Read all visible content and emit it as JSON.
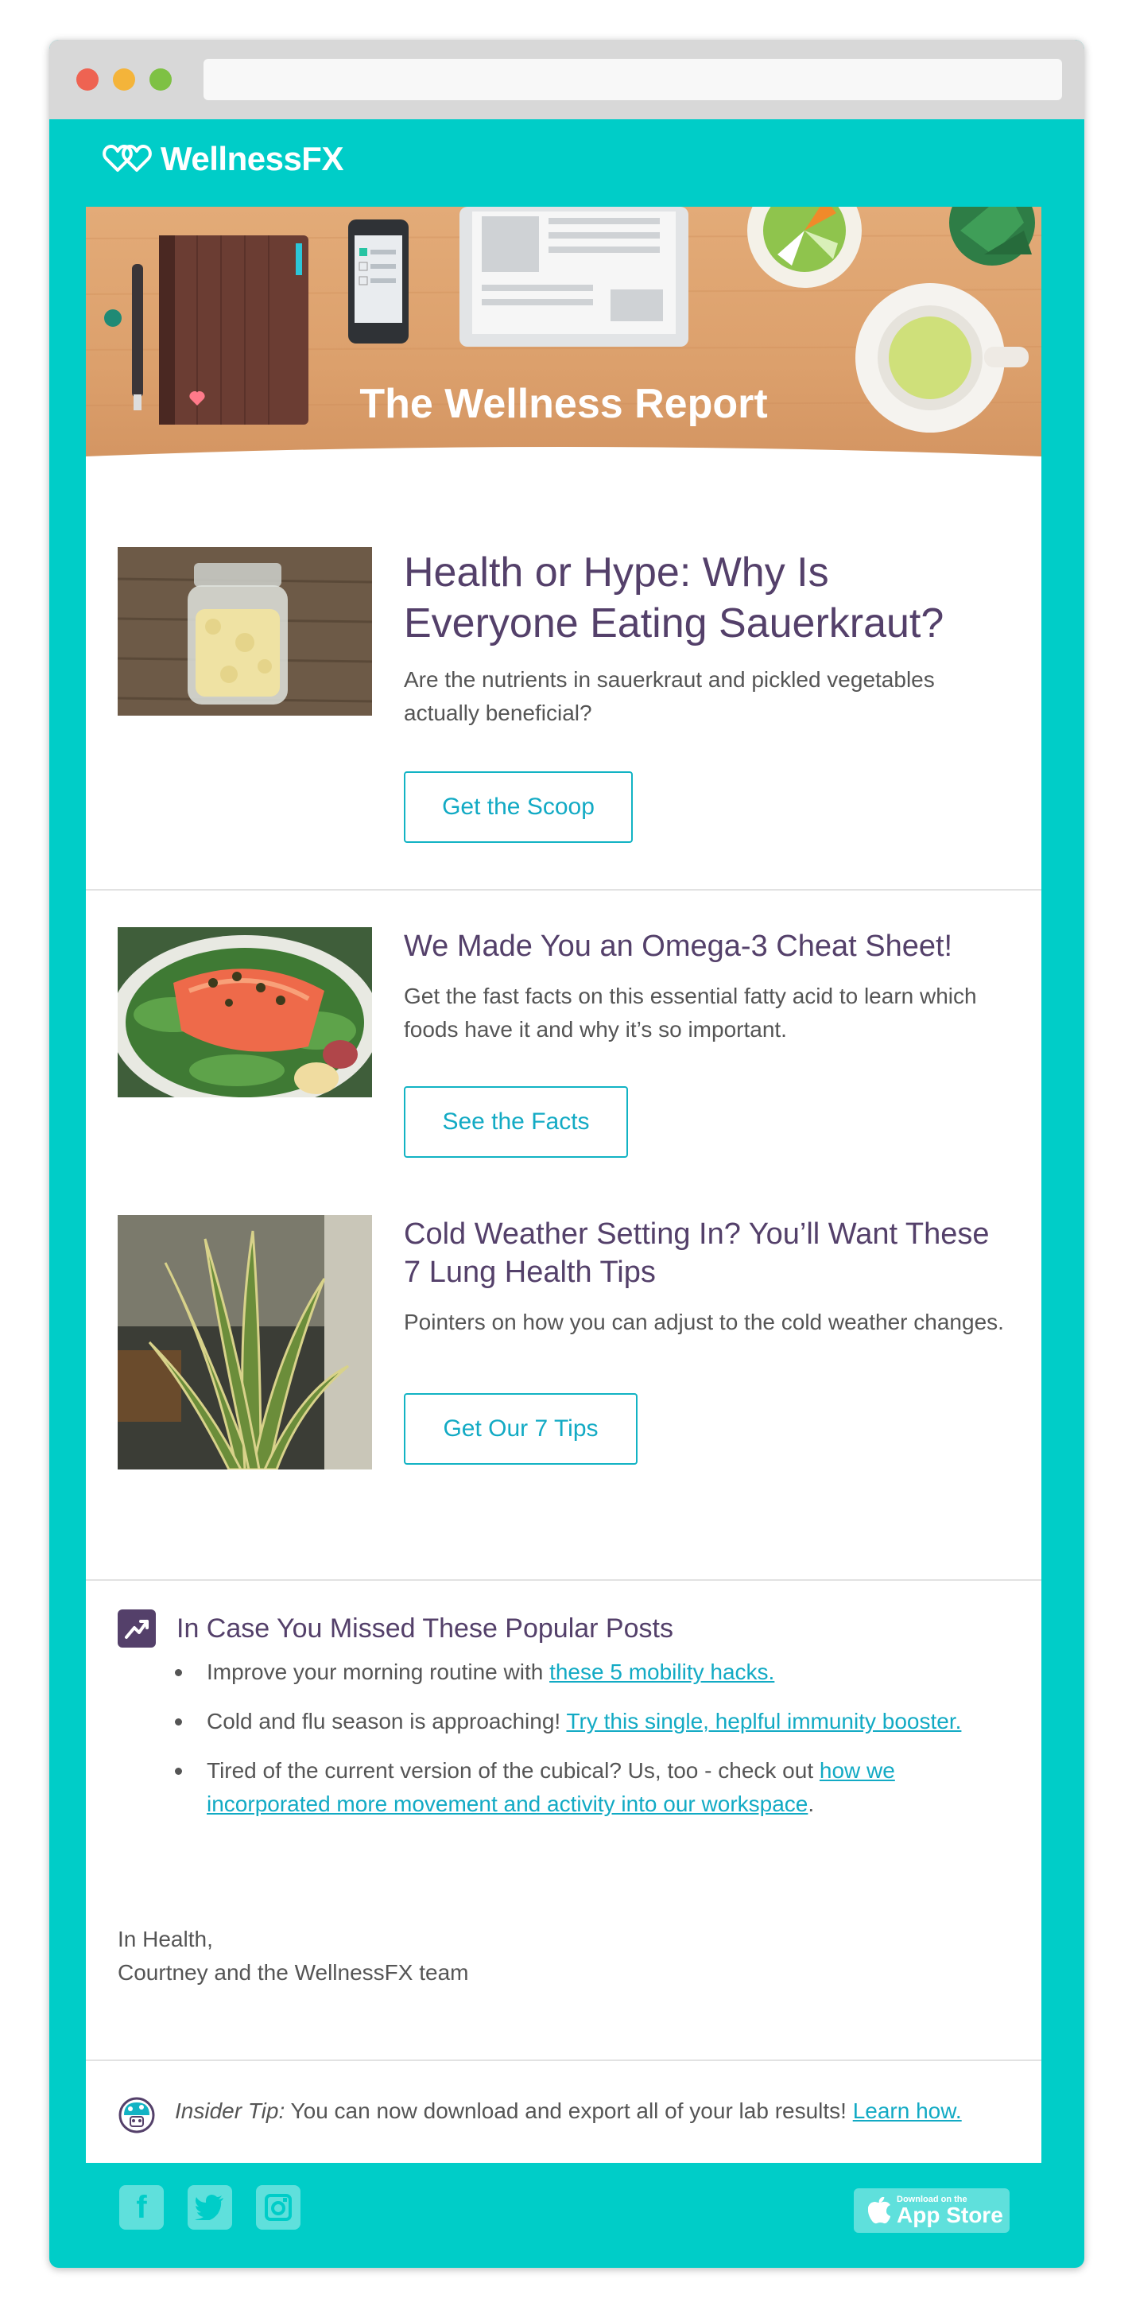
{
  "brand": {
    "name": "WellnessFX",
    "teal": "#00cdc8",
    "purple": "#54406a",
    "link": "#12aac4"
  },
  "hero": {
    "title": "The Wellness Report"
  },
  "articles": [
    {
      "title": "Health or Hype: Why Is Everyone Eating Sauerkraut?",
      "description": "Are the nutrients in sauerkraut and pickled vegetables actually beneficial?",
      "button": "Get the Scoop"
    },
    {
      "title": "We Made You an Omega-3 Cheat Sheet!",
      "description": "Get the fast facts on this essential fatty acid to learn which foods have it and why it’s so important.",
      "button": "See the Facts"
    },
    {
      "title": "Cold Weather Setting In? You’ll Want These 7 Lung Health Tips",
      "description": "Pointers on how you can adjust to the cold weather changes.",
      "button": "Get Our 7 Tips"
    }
  ],
  "popular": {
    "title": "In Case You Missed These Popular Posts",
    "items": [
      {
        "text": "Improve your morning routine with ",
        "link": "these 5 mobility hacks. ",
        "after": ""
      },
      {
        "text": "Cold and flu season is approaching! ",
        "link": "Try this single, heplful immunity booster. ",
        "after": ""
      },
      {
        "text": "Tired of the current version of the cubical? Us, too - check out ",
        "link": "how we incorporated more movement and activity into our workspace",
        "after": "."
      }
    ]
  },
  "signoff": {
    "line1": "In Health,",
    "line2": "Courtney and the WellnessFX team"
  },
  "tip": {
    "label": "Insider Tip:",
    "text": " You can now download and export all of your lab results! ",
    "link": "Learn how."
  },
  "footer": {
    "social": [
      "facebook-icon",
      "twitter-icon",
      "instagram-icon"
    ],
    "appstore_small": "Download on the",
    "appstore_big": "App Store"
  }
}
